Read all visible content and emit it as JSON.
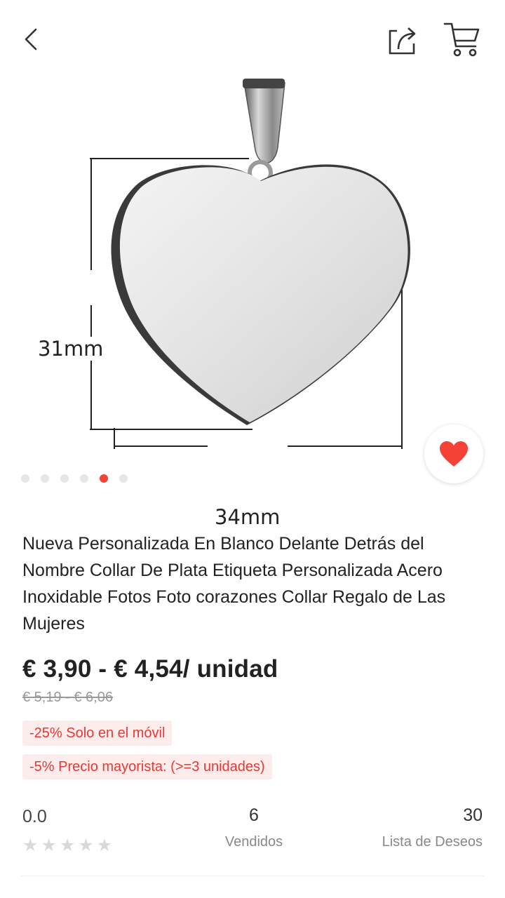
{
  "icons": {
    "back": "chevron-left-icon",
    "share": "share-icon",
    "cart": "cart-icon",
    "favorite": "heart-icon",
    "rating_star": "star-icon"
  },
  "product": {
    "image": {
      "height_label": "31mm",
      "width_label": "34mm"
    },
    "gallery_dots": 6,
    "active_dot": 5,
    "title": "Nueva Personalizada En Blanco Delante Detrás del Nombre Collar De Plata Etiqueta Personalizada Acero Inoxidable Fotos Foto corazones Collar Regalo de Las Mujeres",
    "price": "€ 3,90 - € 4,54/ unidad",
    "original_price": "€ 5,19 - € 6,06",
    "promos": [
      "-25% Solo en el móvil",
      "-5% Precio mayorista: (>=3 unidades)"
    ]
  },
  "stats": {
    "rating": "0.0",
    "stars_filled": 0,
    "stars_total": 5,
    "sold_count": "6",
    "sold_label": "Vendidos",
    "wishlist_count": "30",
    "wishlist_label": "Lista de Deseos"
  },
  "colors": {
    "accent": "#f44336",
    "promo_bg": "#fdecec",
    "promo_text": "#e53935"
  }
}
